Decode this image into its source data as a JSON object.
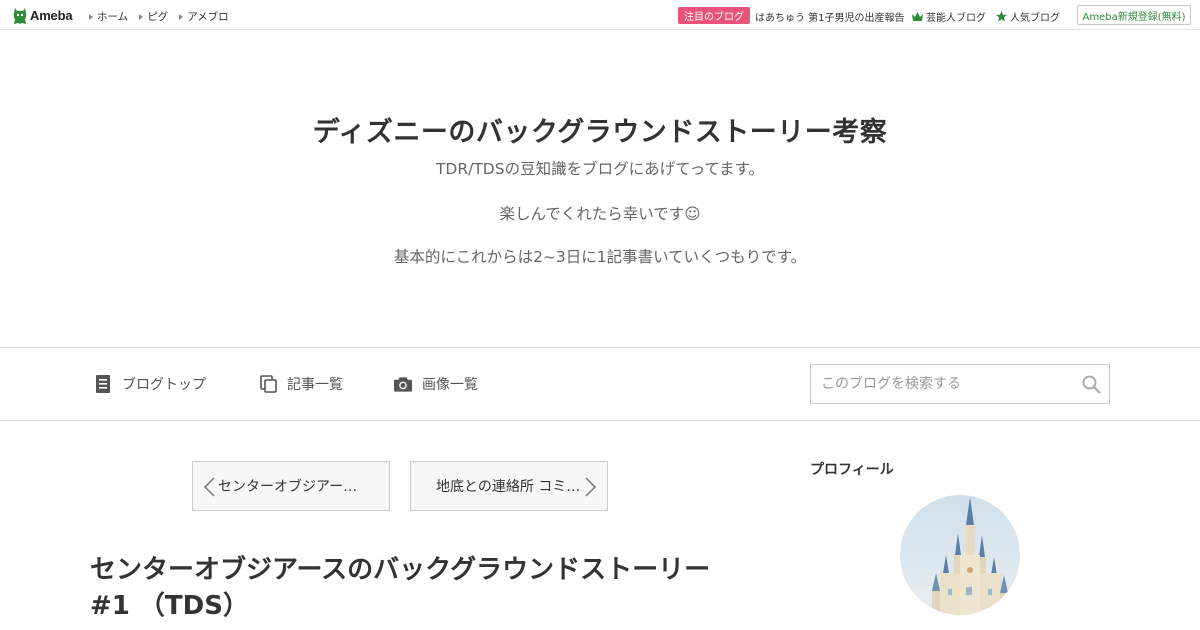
{
  "topbar": {
    "logo_text": "Ameba",
    "nav": [
      "ホーム",
      "ピグ",
      "アメブロ"
    ],
    "featured_badge": "注目のブログ",
    "featured_text": "はあちゅう 第1子男児の出産報告",
    "celebrity_label": "芸能人ブログ",
    "popular_label": "人気ブログ",
    "register_label": "Ameba新規登録(無料)"
  },
  "header": {
    "title": "ディズニーのバックグラウンドストーリー考察",
    "description_lines": [
      "TDR/TDSの豆知識をブログにあげてってます。",
      "楽しんでくれたら幸いです☺",
      "基本的にこれからは2~3日に1記事書いていくつもりです。"
    ]
  },
  "menu": {
    "blog_top": "ブログトップ",
    "article_list": "記事一覧",
    "image_list": "画像一覧",
    "search_placeholder": "このブログを検索する"
  },
  "pager": {
    "prev_label": "センターオブジアー…",
    "next_label": "地底との連絡所 コミ…"
  },
  "article": {
    "title": "センターオブジアースのバックグラウンドストーリー#1 （TDS）"
  },
  "sidebar": {
    "profile_heading": "プロフィール"
  },
  "colors": {
    "badge": "#e9537a",
    "brand_green": "#2d8b3a"
  }
}
